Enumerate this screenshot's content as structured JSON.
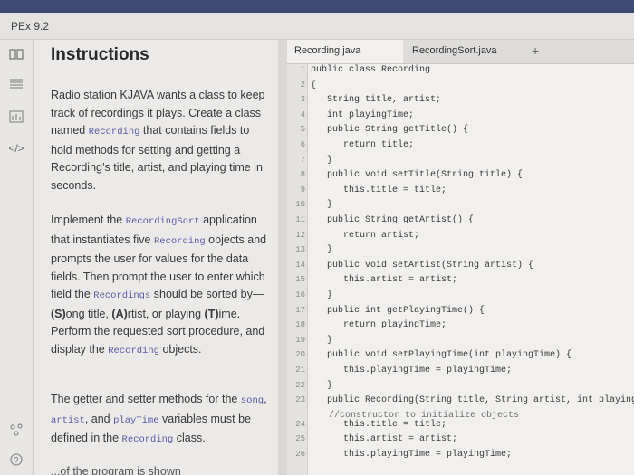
{
  "window": {
    "title": "PEx 9.2"
  },
  "rail": {
    "icons": [
      "book-icon",
      "list-icon",
      "chart-icon",
      "code-icon",
      "share-icon",
      "help-icon"
    ]
  },
  "instructions": {
    "heading": "Instructions",
    "p1": "Radio station KJAVA wants a class to keep track of recordings it plays. Create a class named",
    "p1_code": "Recording",
    "p1b": "that contains fields to hold methods for setting and getting a Recording’s title, artist, and playing time in seconds.",
    "p2a": "Implement the",
    "p2_code1": "RecordingSort",
    "p2b": "application that instantiates five",
    "p2_code2": "Recording",
    "p2c": "objects and prompts the user for values for the data fields. Then prompt the user to enter which field the",
    "p2_code3": "Recordings",
    "p2d": "should be sorted by—",
    "p2_s": "(S)",
    "p2_s2": "ong title,",
    "p2_a": "(A)",
    "p2_a2": "rtist, or playing",
    "p2_t": "(T)",
    "p2_t2": "ime. Perform the requested sort procedure, and display the",
    "p2_code4": "Recording",
    "p2e": "objects.",
    "p3a": "The getter and setter methods for the",
    "p3_song": "song",
    "p3_comma": ",",
    "p3_artist": "artist",
    "p3_and": ", and",
    "p3_play": "playTime",
    "p3b": "variables must be defined in the",
    "p3_rec": "Recording",
    "p3c": "class.",
    "p4": "...of the program is shown"
  },
  "tabs": [
    {
      "label": "Recording.java",
      "active": true
    },
    {
      "label": "RecordingSort.java",
      "active": false
    },
    {
      "label": "+",
      "active": false
    }
  ],
  "code": {
    "line_numbers": [
      "1",
      "2",
      "3",
      "4",
      "5",
      "6",
      "7",
      "8",
      "9",
      "10",
      "11",
      "12",
      "13",
      "14",
      "15",
      "16",
      "17",
      "18",
      "19",
      "20",
      "21",
      "22",
      "23",
      "24",
      "25",
      "26"
    ],
    "lines": [
      "public class Recording",
      "{",
      "   String title, artist;",
      "   int playingTime;",
      "   public String getTitle() {",
      "      return title;",
      "   }",
      "   public void setTitle(String title) {",
      "      this.title = title;",
      "   }",
      "   public String getArtist() {",
      "      return artist;",
      "   }",
      "   public void setArtist(String artist) {",
      "      this.artist = artist;",
      "   }",
      "   public int getPlayingTime() {",
      "      return playingTime;",
      "   }",
      "   public void setPlayingTime(int playingTime) {",
      "      this.playingTime = playingTime;",
      "   }",
      "   public Recording(String title, String artist, int playingTi",
      "      this.title = title;",
      "      this.artist = artist;",
      "      this.playingTime = playingTime;"
    ],
    "comment_line": "//constructor to initialize objects"
  }
}
